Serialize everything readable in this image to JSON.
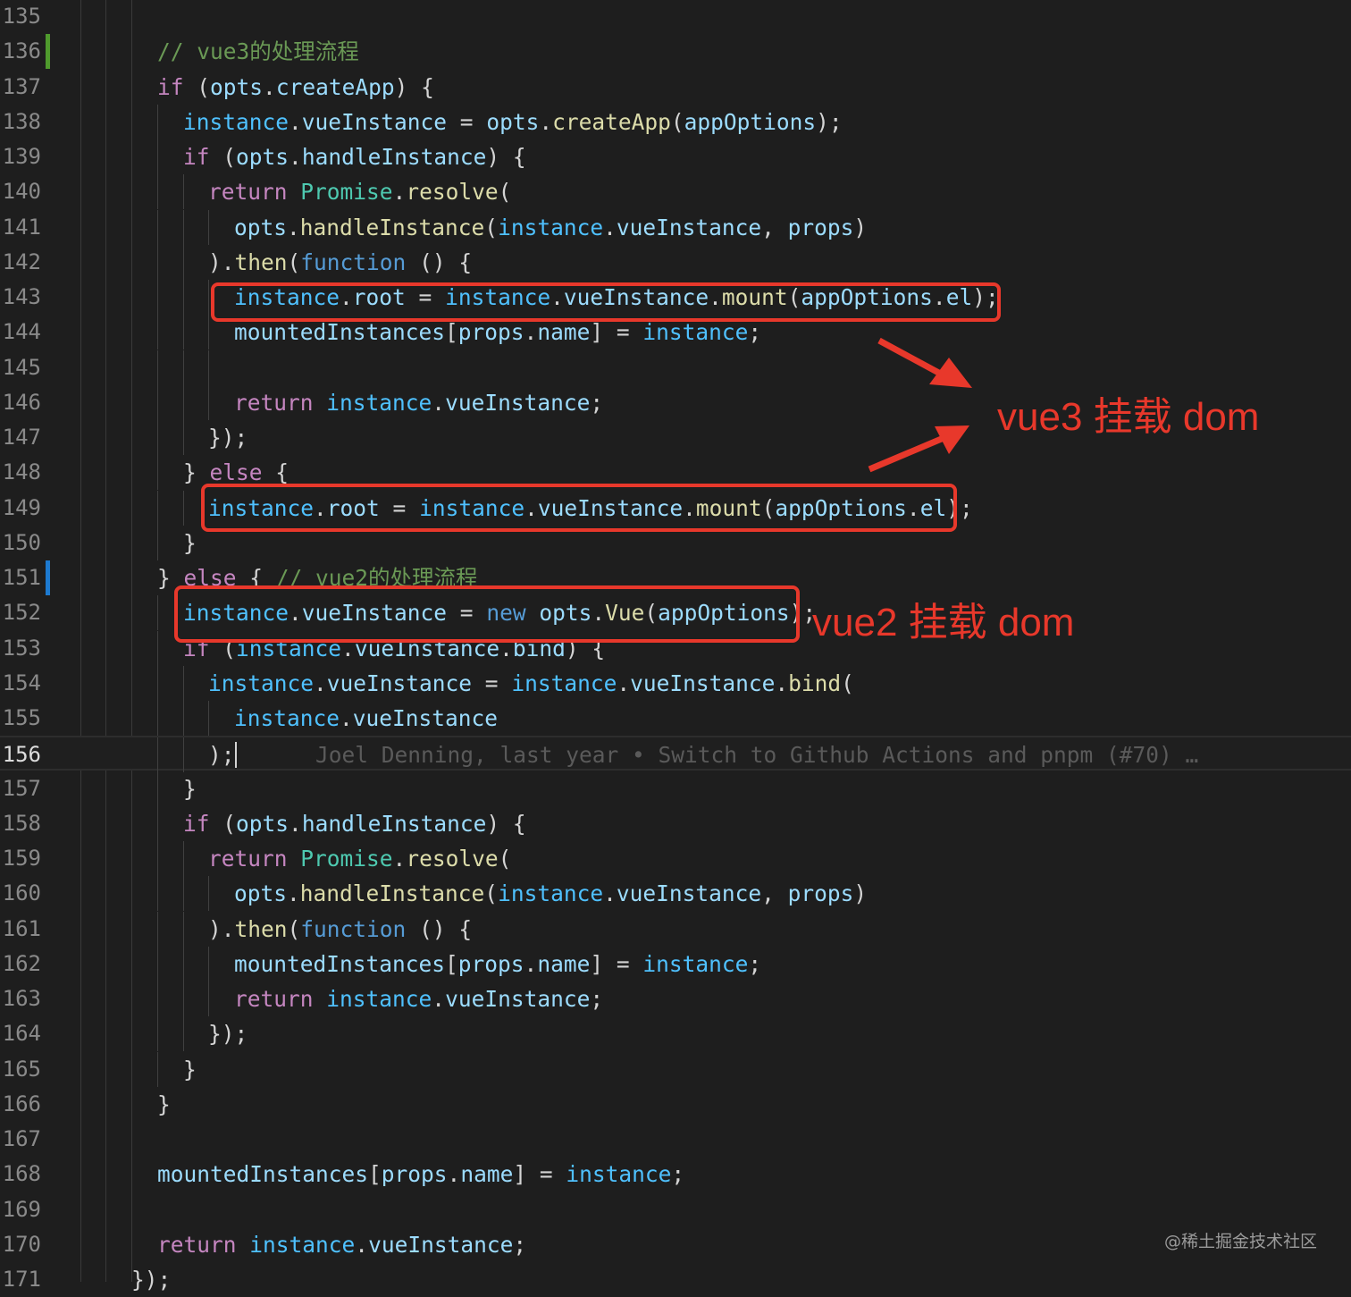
{
  "colors": {
    "background": "#1e1e1e",
    "keyword": "#c586c0",
    "storage": "#569cd6",
    "variable": "#4fc1ff",
    "property": "#9cdcfe",
    "function": "#dcdcaa",
    "class": "#4ec9b0",
    "comment": "#6a9955",
    "annotation_red": "#e8382b",
    "git_modified": "#1d7ad0",
    "git_added": "#4f9a2d"
  },
  "lines": [
    {
      "n": "135",
      "tokens": []
    },
    {
      "n": "136",
      "git": "added",
      "tokens": [
        {
          "t": "// vue3的处理流程",
          "c": "cmt"
        }
      ]
    },
    {
      "n": "137",
      "tokens": [
        {
          "t": "if",
          "c": "kw"
        },
        {
          "t": " (",
          "c": "punc"
        },
        {
          "t": "opts",
          "c": "prop"
        },
        {
          "t": ".",
          "c": "punc"
        },
        {
          "t": "createApp",
          "c": "prop"
        },
        {
          "t": ") {",
          "c": "punc"
        }
      ]
    },
    {
      "n": "138",
      "tokens": [
        {
          "t": "instance",
          "c": "var"
        },
        {
          "t": ".",
          "c": "punc"
        },
        {
          "t": "vueInstance",
          "c": "prop"
        },
        {
          "t": " = ",
          "c": "punc"
        },
        {
          "t": "opts",
          "c": "prop"
        },
        {
          "t": ".",
          "c": "punc"
        },
        {
          "t": "createApp",
          "c": "fn"
        },
        {
          "t": "(",
          "c": "punc"
        },
        {
          "t": "appOptions",
          "c": "prop"
        },
        {
          "t": ");",
          "c": "punc"
        }
      ]
    },
    {
      "n": "139",
      "tokens": [
        {
          "t": "if",
          "c": "kw"
        },
        {
          "t": " (",
          "c": "punc"
        },
        {
          "t": "opts",
          "c": "prop"
        },
        {
          "t": ".",
          "c": "punc"
        },
        {
          "t": "handleInstance",
          "c": "prop"
        },
        {
          "t": ") {",
          "c": "punc"
        }
      ]
    },
    {
      "n": "140",
      "tokens": [
        {
          "t": "return",
          "c": "kw"
        },
        {
          "t": " ",
          "c": "punc"
        },
        {
          "t": "Promise",
          "c": "cls"
        },
        {
          "t": ".",
          "c": "punc"
        },
        {
          "t": "resolve",
          "c": "fn"
        },
        {
          "t": "(",
          "c": "punc"
        }
      ]
    },
    {
      "n": "141",
      "tokens": [
        {
          "t": "opts",
          "c": "prop"
        },
        {
          "t": ".",
          "c": "punc"
        },
        {
          "t": "handleInstance",
          "c": "fn"
        },
        {
          "t": "(",
          "c": "punc"
        },
        {
          "t": "instance",
          "c": "var"
        },
        {
          "t": ".",
          "c": "punc"
        },
        {
          "t": "vueInstance",
          "c": "prop"
        },
        {
          "t": ", ",
          "c": "punc"
        },
        {
          "t": "props",
          "c": "prop"
        },
        {
          "t": ")",
          "c": "punc"
        }
      ]
    },
    {
      "n": "142",
      "tokens": [
        {
          "t": ").",
          "c": "punc"
        },
        {
          "t": "then",
          "c": "fn"
        },
        {
          "t": "(",
          "c": "punc"
        },
        {
          "t": "function",
          "c": "kw2"
        },
        {
          "t": " () {",
          "c": "punc"
        }
      ]
    },
    {
      "n": "143",
      "tokens": [
        {
          "t": "instance",
          "c": "var"
        },
        {
          "t": ".",
          "c": "punc"
        },
        {
          "t": "root",
          "c": "prop"
        },
        {
          "t": " = ",
          "c": "punc"
        },
        {
          "t": "instance",
          "c": "var"
        },
        {
          "t": ".",
          "c": "punc"
        },
        {
          "t": "vueInstance",
          "c": "prop"
        },
        {
          "t": ".",
          "c": "punc"
        },
        {
          "t": "mount",
          "c": "fn"
        },
        {
          "t": "(",
          "c": "punc"
        },
        {
          "t": "appOptions",
          "c": "prop"
        },
        {
          "t": ".",
          "c": "punc"
        },
        {
          "t": "el",
          "c": "prop"
        },
        {
          "t": ");",
          "c": "punc"
        }
      ]
    },
    {
      "n": "144",
      "tokens": [
        {
          "t": "mountedInstances",
          "c": "prop"
        },
        {
          "t": "[",
          "c": "punc"
        },
        {
          "t": "props",
          "c": "prop"
        },
        {
          "t": ".",
          "c": "punc"
        },
        {
          "t": "name",
          "c": "prop"
        },
        {
          "t": "] = ",
          "c": "punc"
        },
        {
          "t": "instance",
          "c": "var"
        },
        {
          "t": ";",
          "c": "punc"
        }
      ]
    },
    {
      "n": "145",
      "tokens": []
    },
    {
      "n": "146",
      "tokens": [
        {
          "t": "return",
          "c": "kw"
        },
        {
          "t": " ",
          "c": "punc"
        },
        {
          "t": "instance",
          "c": "var"
        },
        {
          "t": ".",
          "c": "punc"
        },
        {
          "t": "vueInstance",
          "c": "prop"
        },
        {
          "t": ";",
          "c": "punc"
        }
      ]
    },
    {
      "n": "147",
      "tokens": [
        {
          "t": "});",
          "c": "punc"
        }
      ]
    },
    {
      "n": "148",
      "tokens": [
        {
          "t": "} ",
          "c": "punc"
        },
        {
          "t": "else",
          "c": "kw"
        },
        {
          "t": " {",
          "c": "punc"
        }
      ]
    },
    {
      "n": "149",
      "tokens": [
        {
          "t": "instance",
          "c": "var"
        },
        {
          "t": ".",
          "c": "punc"
        },
        {
          "t": "root",
          "c": "prop"
        },
        {
          "t": " = ",
          "c": "punc"
        },
        {
          "t": "instance",
          "c": "var"
        },
        {
          "t": ".",
          "c": "punc"
        },
        {
          "t": "vueInstance",
          "c": "prop"
        },
        {
          "t": ".",
          "c": "punc"
        },
        {
          "t": "mount",
          "c": "fn"
        },
        {
          "t": "(",
          "c": "punc"
        },
        {
          "t": "appOptions",
          "c": "prop"
        },
        {
          "t": ".",
          "c": "punc"
        },
        {
          "t": "el",
          "c": "prop"
        },
        {
          "t": ");",
          "c": "punc"
        }
      ]
    },
    {
      "n": "150",
      "tokens": [
        {
          "t": "}",
          "c": "punc"
        }
      ]
    },
    {
      "n": "151",
      "git": "modified",
      "tokens": [
        {
          "t": "} ",
          "c": "punc"
        },
        {
          "t": "else",
          "c": "kw"
        },
        {
          "t": " { ",
          "c": "punc"
        },
        {
          "t": "// vue2的处理流程",
          "c": "cmt"
        }
      ]
    },
    {
      "n": "152",
      "tokens": [
        {
          "t": "instance",
          "c": "var"
        },
        {
          "t": ".",
          "c": "punc"
        },
        {
          "t": "vueInstance",
          "c": "prop"
        },
        {
          "t": " = ",
          "c": "punc"
        },
        {
          "t": "new",
          "c": "kw2"
        },
        {
          "t": " ",
          "c": "punc"
        },
        {
          "t": "opts",
          "c": "prop"
        },
        {
          "t": ".",
          "c": "punc"
        },
        {
          "t": "Vue",
          "c": "fn"
        },
        {
          "t": "(",
          "c": "punc"
        },
        {
          "t": "appOptions",
          "c": "prop"
        },
        {
          "t": ");",
          "c": "punc"
        }
      ]
    },
    {
      "n": "153",
      "tokens": [
        {
          "t": "if",
          "c": "kw"
        },
        {
          "t": " (",
          "c": "punc"
        },
        {
          "t": "instance",
          "c": "var"
        },
        {
          "t": ".",
          "c": "punc"
        },
        {
          "t": "vueInstance",
          "c": "prop"
        },
        {
          "t": ".",
          "c": "punc"
        },
        {
          "t": "bind",
          "c": "prop"
        },
        {
          "t": ") {",
          "c": "punc"
        }
      ]
    },
    {
      "n": "154",
      "tokens": [
        {
          "t": "instance",
          "c": "var"
        },
        {
          "t": ".",
          "c": "punc"
        },
        {
          "t": "vueInstance",
          "c": "prop"
        },
        {
          "t": " = ",
          "c": "punc"
        },
        {
          "t": "instance",
          "c": "var"
        },
        {
          "t": ".",
          "c": "punc"
        },
        {
          "t": "vueInstance",
          "c": "prop"
        },
        {
          "t": ".",
          "c": "punc"
        },
        {
          "t": "bind",
          "c": "fn"
        },
        {
          "t": "(",
          "c": "punc"
        }
      ]
    },
    {
      "n": "155",
      "tokens": [
        {
          "t": "instance",
          "c": "var"
        },
        {
          "t": ".",
          "c": "punc"
        },
        {
          "t": "vueInstance",
          "c": "prop"
        }
      ]
    },
    {
      "n": "156",
      "current": true,
      "tokens": [
        {
          "t": ");",
          "c": "punc"
        }
      ],
      "blame": "Joel Denning, last year • Switch to Github Actions and pnpm (#70) …"
    },
    {
      "n": "157",
      "tokens": [
        {
          "t": "}",
          "c": "punc"
        }
      ]
    },
    {
      "n": "158",
      "tokens": [
        {
          "t": "if",
          "c": "kw"
        },
        {
          "t": " (",
          "c": "punc"
        },
        {
          "t": "opts",
          "c": "prop"
        },
        {
          "t": ".",
          "c": "punc"
        },
        {
          "t": "handleInstance",
          "c": "prop"
        },
        {
          "t": ") {",
          "c": "punc"
        }
      ]
    },
    {
      "n": "159",
      "tokens": [
        {
          "t": "return",
          "c": "kw"
        },
        {
          "t": " ",
          "c": "punc"
        },
        {
          "t": "Promise",
          "c": "cls"
        },
        {
          "t": ".",
          "c": "punc"
        },
        {
          "t": "resolve",
          "c": "fn"
        },
        {
          "t": "(",
          "c": "punc"
        }
      ]
    },
    {
      "n": "160",
      "tokens": [
        {
          "t": "opts",
          "c": "prop"
        },
        {
          "t": ".",
          "c": "punc"
        },
        {
          "t": "handleInstance",
          "c": "fn"
        },
        {
          "t": "(",
          "c": "punc"
        },
        {
          "t": "instance",
          "c": "var"
        },
        {
          "t": ".",
          "c": "punc"
        },
        {
          "t": "vueInstance",
          "c": "prop"
        },
        {
          "t": ", ",
          "c": "punc"
        },
        {
          "t": "props",
          "c": "prop"
        },
        {
          "t": ")",
          "c": "punc"
        }
      ]
    },
    {
      "n": "161",
      "tokens": [
        {
          "t": ").",
          "c": "punc"
        },
        {
          "t": "then",
          "c": "fn"
        },
        {
          "t": "(",
          "c": "punc"
        },
        {
          "t": "function",
          "c": "kw2"
        },
        {
          "t": " () {",
          "c": "punc"
        }
      ]
    },
    {
      "n": "162",
      "tokens": [
        {
          "t": "mountedInstances",
          "c": "prop"
        },
        {
          "t": "[",
          "c": "punc"
        },
        {
          "t": "props",
          "c": "prop"
        },
        {
          "t": ".",
          "c": "punc"
        },
        {
          "t": "name",
          "c": "prop"
        },
        {
          "t": "] = ",
          "c": "punc"
        },
        {
          "t": "instance",
          "c": "var"
        },
        {
          "t": ";",
          "c": "punc"
        }
      ]
    },
    {
      "n": "163",
      "tokens": [
        {
          "t": "return",
          "c": "kw"
        },
        {
          "t": " ",
          "c": "punc"
        },
        {
          "t": "instance",
          "c": "var"
        },
        {
          "t": ".",
          "c": "punc"
        },
        {
          "t": "vueInstance",
          "c": "prop"
        },
        {
          "t": ";",
          "c": "punc"
        }
      ]
    },
    {
      "n": "164",
      "tokens": [
        {
          "t": "});",
          "c": "punc"
        }
      ]
    },
    {
      "n": "165",
      "tokens": [
        {
          "t": "}",
          "c": "punc"
        }
      ]
    },
    {
      "n": "166",
      "tokens": [
        {
          "t": "}",
          "c": "punc"
        }
      ]
    },
    {
      "n": "167",
      "tokens": []
    },
    {
      "n": "168",
      "tokens": [
        {
          "t": "mountedInstances",
          "c": "prop"
        },
        {
          "t": "[",
          "c": "punc"
        },
        {
          "t": "props",
          "c": "prop"
        },
        {
          "t": ".",
          "c": "punc"
        },
        {
          "t": "name",
          "c": "prop"
        },
        {
          "t": "] = ",
          "c": "punc"
        },
        {
          "t": "instance",
          "c": "var"
        },
        {
          "t": ";",
          "c": "punc"
        }
      ]
    },
    {
      "n": "169",
      "tokens": []
    },
    {
      "n": "170",
      "tokens": [
        {
          "t": "return",
          "c": "kw"
        },
        {
          "t": " ",
          "c": "punc"
        },
        {
          "t": "instance",
          "c": "var"
        },
        {
          "t": ".",
          "c": "punc"
        },
        {
          "t": "vueInstance",
          "c": "prop"
        },
        {
          "t": ";",
          "c": "punc"
        }
      ]
    },
    {
      "n": "171",
      "tokens": [
        {
          "t": "});",
          "c": "punc"
        }
      ]
    }
  ],
  "annotations": {
    "vue3_label": "vue3 挂载 dom",
    "vue2_label": "vue2 挂载 dom"
  },
  "watermark": "@稀土掘金技术社区"
}
